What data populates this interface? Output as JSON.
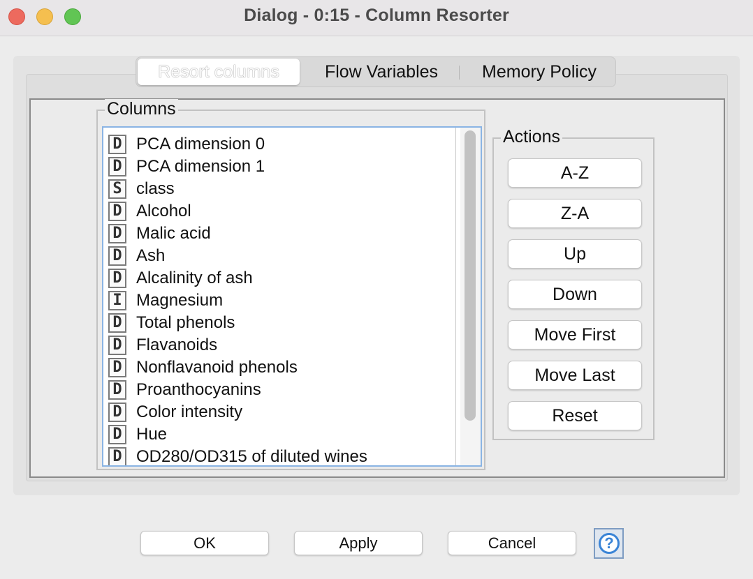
{
  "window": {
    "title": "Dialog - 0:15 - Column Resorter"
  },
  "tabs": [
    {
      "label": "Resort columns",
      "selected": true
    },
    {
      "label": "Flow Variables",
      "selected": false
    },
    {
      "label": "Memory Policy",
      "selected": false
    }
  ],
  "columns_group": {
    "label": "Columns",
    "items": [
      {
        "type": "D",
        "name": "PCA dimension 0"
      },
      {
        "type": "D",
        "name": "PCA dimension 1"
      },
      {
        "type": "S",
        "name": "class"
      },
      {
        "type": "D",
        "name": "Alcohol"
      },
      {
        "type": "D",
        "name": "Malic acid"
      },
      {
        "type": "D",
        "name": "Ash"
      },
      {
        "type": "D",
        "name": "Alcalinity of ash"
      },
      {
        "type": "I",
        "name": "Magnesium"
      },
      {
        "type": "D",
        "name": "Total phenols"
      },
      {
        "type": "D",
        "name": "Flavanoids"
      },
      {
        "type": "D",
        "name": "Nonflavanoid phenols"
      },
      {
        "type": "D",
        "name": "Proanthocyanins"
      },
      {
        "type": "D",
        "name": "Color intensity"
      },
      {
        "type": "D",
        "name": "Hue"
      },
      {
        "type": "D",
        "name": "OD280/OD315 of diluted wines"
      }
    ]
  },
  "actions_group": {
    "label": "Actions",
    "buttons": [
      "A-Z",
      "Z-A",
      "Up",
      "Down",
      "Move First",
      "Move Last",
      "Reset"
    ]
  },
  "footer": {
    "ok_label": "OK",
    "apply_label": "Apply",
    "cancel_label": "Cancel",
    "help_icon": "help-icon"
  },
  "colors": {
    "close": "#ed6a5e",
    "minimize": "#f5bf4f",
    "maximize": "#61c554",
    "selection_border": "#8ab4e4",
    "help_accent": "#3a84d6"
  }
}
